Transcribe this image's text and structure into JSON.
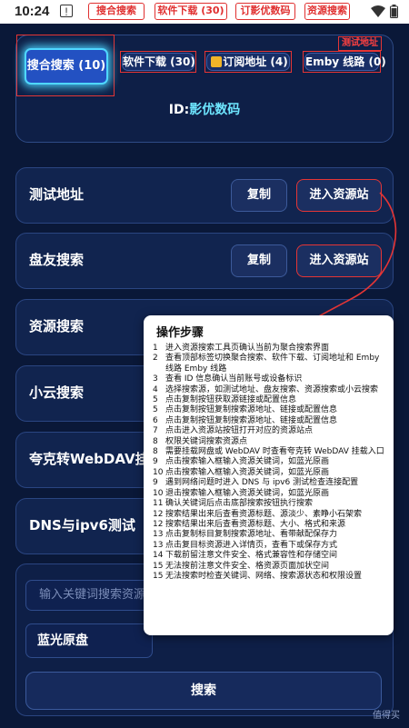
{
  "status_bar": {
    "time": "10:24",
    "tags": [
      "搜合搜索",
      "软件下载 (30)",
      "订影优数码",
      "资源搜索"
    ]
  },
  "tabs": [
    {
      "label": "搜合搜索 (10)"
    },
    {
      "label": "软件下载 (30)"
    },
    {
      "label": "订阅地址 (4)"
    },
    {
      "label": "Emby 线路 (0)"
    }
  ],
  "corner_label": "测试地址",
  "id_line": {
    "prefix": "ID:",
    "value": "影优数码"
  },
  "rows": [
    {
      "label": "测试地址",
      "copy": "复制",
      "enter": "进入资源站"
    },
    {
      "label": "盘友搜索",
      "copy": "复制",
      "enter": "进入资源站"
    },
    {
      "label": "资源搜索"
    },
    {
      "label": "小云搜索"
    },
    {
      "label": "夸克转WebDAV挂载"
    },
    {
      "label": "DNS与ipv6测试"
    }
  ],
  "search": {
    "placeholder": "输入关键词搜索资源",
    "source": "蓝光原盘",
    "button": "搜索"
  },
  "popup": {
    "title": "操作步骤",
    "steps": [
      {
        "no": "1",
        "text": "进入资源搜索工具页确认当前为聚合搜索界面"
      },
      {
        "no": "2",
        "text": "查看顶部标签切换聚合搜索、软件下载、订阅地址和 Emby线路 Emby 线路"
      },
      {
        "no": "3",
        "text": "查看 ID 信息确认当前账号或设备标识"
      },
      {
        "no": "4",
        "text": "选择搜索源，如测试地址、盘友搜索、资源搜索或小云搜索"
      },
      {
        "no": "5",
        "text": "点击复制按钮获取源链接或配置信息"
      },
      {
        "no": "5",
        "text": "点击复制按钮复制搜索源地址、链接或配置信息"
      },
      {
        "no": "6",
        "text": "点击复制按钮复制搜索源地址、链接或配置信息"
      },
      {
        "no": "7",
        "text": "点击进入资源站按钮打开对应的资源站点"
      },
      {
        "no": "8",
        "text": "权限关键词搜索资源点"
      },
      {
        "no": "8",
        "text": "需要挂载网盘或 WebDAV 时查看夸克转 WebDAV 挂载入口"
      },
      {
        "no": "9",
        "text": "点击搜索输入框输入资源关键词，如蓝光原画"
      },
      {
        "no": "10",
        "text": "点击搜索输入框输入资源关键词，如蓝光原画"
      },
      {
        "no": "9",
        "text": "遇到网络问题时进入 DNS 与 ipv6 测试检查连接配置"
      },
      {
        "no": "10",
        "text": "退击搜索输入框输入资源关键词，如蓝光原画"
      },
      {
        "no": "11",
        "text": "确认关键词后点击底部搜索按钮执行搜索"
      },
      {
        "no": "12",
        "text": "搜索结果出来后查看资源标题、源淡少、素睁小石架索"
      },
      {
        "no": "12",
        "text": "搜索结果出来后查看资源标题、大小、格式和来源"
      },
      {
        "no": "13",
        "text": "点击复制标目复制搜索源地址、看带献配保存力"
      },
      {
        "no": "13",
        "text": "点击复目标资源进入详情页，查看下或保存方式"
      },
      {
        "no": "14",
        "text": "下载前留注意文件安全、格式兼容性和存储空间"
      },
      {
        "no": "15",
        "text": "无法搜前注意文件安全、格资源页面加状空间"
      },
      {
        "no": "15",
        "text": "无法搜索时检查关键词、网络、搜索源状态和权限设置"
      }
    ]
  },
  "watermark": "值得买"
}
